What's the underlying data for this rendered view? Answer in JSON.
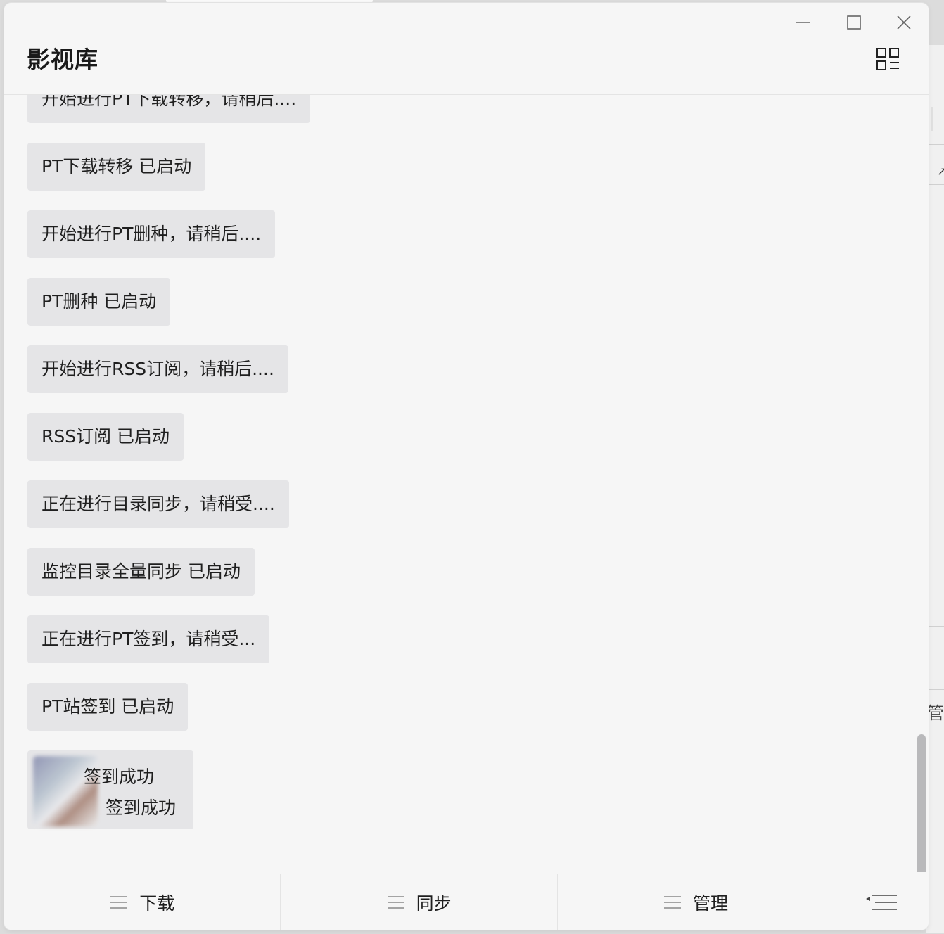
{
  "window": {
    "title": "影视库",
    "controls": {
      "minimize": "minimize-icon",
      "maximize": "maximize-icon",
      "close": "close-icon"
    },
    "menu_icon": "grid-menu-icon"
  },
  "messages": [
    {
      "text": "开始进行PT下载转移，请稍后...."
    },
    {
      "text": "PT下载转移 已启动"
    },
    {
      "text": "开始进行PT删种，请稍后...."
    },
    {
      "text": "PT删种 已启动"
    },
    {
      "text": "开始进行RSS订阅，请稍后...."
    },
    {
      "text": "RSS订阅 已启动"
    },
    {
      "text": "正在进行目录同步，请稍受...."
    },
    {
      "text": "监控目录全量同步 已启动"
    },
    {
      "text": "正在进行PT签到，请稍受..."
    },
    {
      "text": "PT站签到 已启动"
    }
  ],
  "signin_result": {
    "line1": "签到成功",
    "line2": "签到成功"
  },
  "bottom_tabs": [
    {
      "label": "下载",
      "icon": "hamburger-icon"
    },
    {
      "label": "同步",
      "icon": "hamburger-icon"
    },
    {
      "label": "管理",
      "icon": "hamburger-icon"
    }
  ],
  "bottom_menu_icon": "menu-collapse-icon",
  "background_window": {
    "partial_text": "管理"
  }
}
